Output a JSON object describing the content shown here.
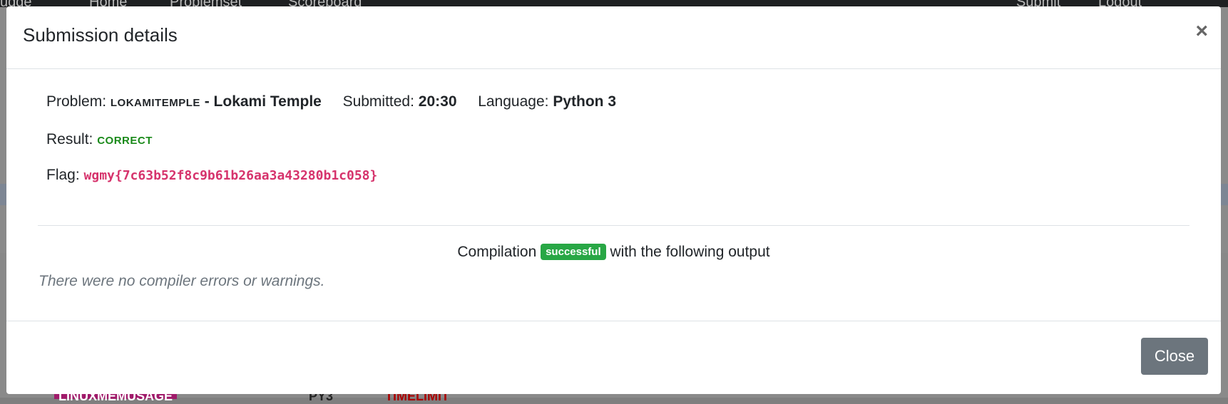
{
  "background": {
    "navbar_items": [
      "udge",
      "Home",
      "Problemset",
      "Scoreboard",
      "Submit",
      "Logout"
    ],
    "bottom_items": [
      "LINUXMEMUSAGE",
      "PY3",
      "TIMELIMIT"
    ]
  },
  "modal": {
    "title": "Submission details",
    "close_icon": "×",
    "problem_label": "Problem:",
    "problem_id": "lokamitemple",
    "problem_name": "- Lokami Temple",
    "submitted_label": "Submitted:",
    "submitted_value": "20:30",
    "language_label": "Language:",
    "language_value": "Python 3",
    "result_label": "Result:",
    "result_value": "correct",
    "flag_label": "Flag:",
    "flag_value": "wgmy{7c63b52f8c9b61b26aa3a43280b1c058}",
    "compile_prefix": "Compilation",
    "compile_badge": "successful",
    "compile_suffix": "with the following output",
    "compiler_note": "There were no compiler errors or warnings.",
    "close_button": "Close"
  },
  "colors": {
    "correct": "#1a8a1a",
    "flag": "#d6336c",
    "badge": "#28a745",
    "button": "#6c757d"
  }
}
